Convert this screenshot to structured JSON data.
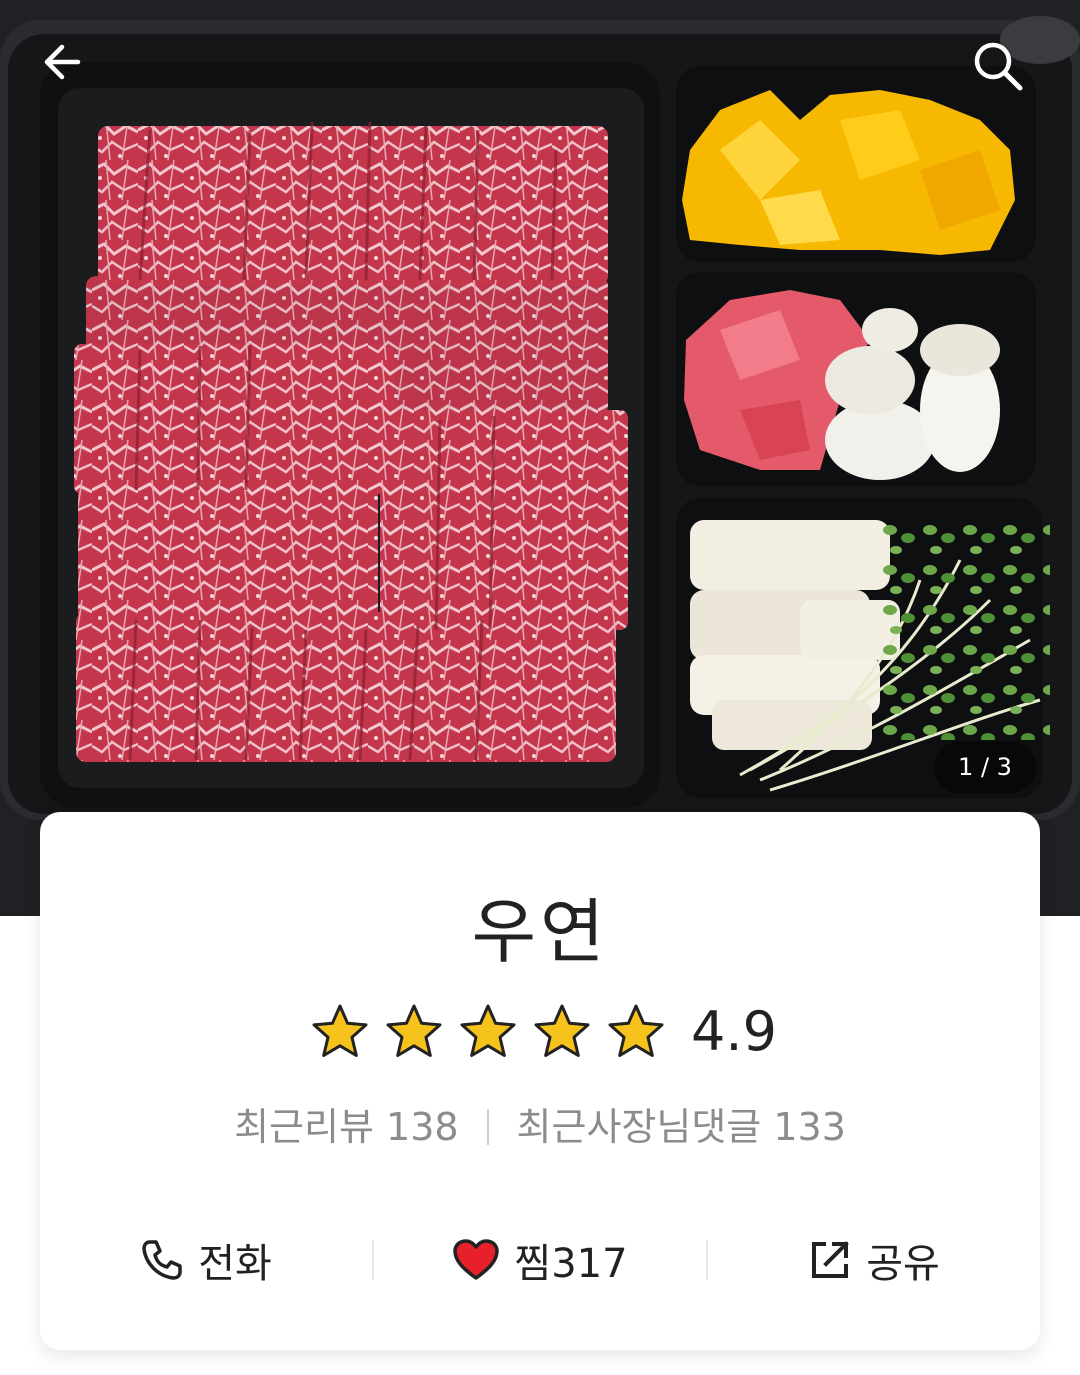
{
  "header": {
    "back_icon": "arrow-left-icon",
    "search_icon": "search-icon"
  },
  "gallery": {
    "counter": "1 / 3",
    "image_description_icon": "food-photo"
  },
  "shop": {
    "name": "우연",
    "rating": "4.9",
    "stars_filled": 5,
    "stars_total": 5,
    "star_color": "#f6c21c",
    "recent_reviews": "최근리뷰 138",
    "recent_owner_comments": "최근사장님댓글 133"
  },
  "actions": {
    "call_label": "전화",
    "call_icon": "phone-icon",
    "like_label": "찜317",
    "like_icon": "heart-icon",
    "like_color": "#e8202a",
    "share_label": "공유",
    "share_icon": "share-icon"
  }
}
